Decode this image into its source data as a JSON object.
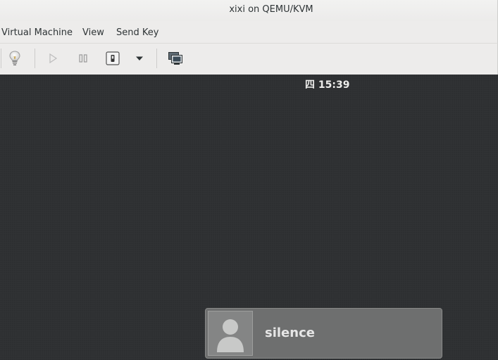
{
  "window": {
    "title": "xixi on QEMU/KVM"
  },
  "menubar": {
    "items": [
      "Virtual Machine",
      "View",
      "Send Key"
    ]
  },
  "toolbar": {
    "buttons": [
      {
        "icon": "lightbulb-icon",
        "enabled": true
      },
      {
        "icon": "play-icon",
        "enabled": false
      },
      {
        "icon": "pause-icon",
        "enabled": false
      },
      {
        "icon": "power-icon",
        "enabled": true
      },
      {
        "icon": "chevron-down-icon",
        "enabled": true
      },
      {
        "icon": "screens-icon",
        "enabled": true
      }
    ]
  },
  "guest": {
    "clock": "四 15:39",
    "user": {
      "name": "silence",
      "avatar_icon": "user-avatar-icon"
    }
  },
  "colors": {
    "desktop_bg": "#2d2f31",
    "chrome_bg": "#edeceb",
    "card_bg": "#6e6f6f"
  }
}
